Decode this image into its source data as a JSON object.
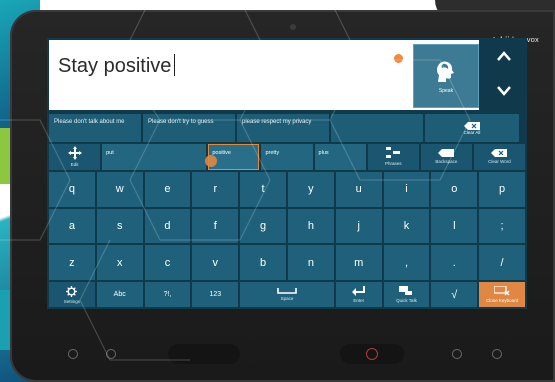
{
  "device": {
    "brand_bold": "tobii",
    "brand_light": "dynavox"
  },
  "message": {
    "text": "Stay positive",
    "speak_label": "Speak",
    "speak_icon": "speaking-head-icon",
    "scroll_up_icon": "chevron-up-icon",
    "scroll_down_icon": "chevron-down-icon"
  },
  "phrases": [
    "Please don't talk about me",
    "Please don't try to guess",
    "please respect my privacy",
    ""
  ],
  "clear_all": {
    "label": "Clear All"
  },
  "predictions": {
    "edit": "Edit",
    "words": [
      "put",
      "positive",
      "pretty",
      "plus"
    ],
    "selected_index": 1,
    "phrases": "Phrases",
    "backspace": "Backspace",
    "clear_word": "Clear Word"
  },
  "keyboard": {
    "row1": [
      "q",
      "w",
      "e",
      "r",
      "t",
      "y",
      "u",
      "i",
      "o",
      "p"
    ],
    "row2": [
      "a",
      "s",
      "d",
      "f",
      "g",
      "h",
      "j",
      "k",
      "l",
      ";"
    ],
    "row3": [
      "z",
      "x",
      "c",
      "v",
      "b",
      "n",
      "m",
      ",",
      ".",
      "/"
    ],
    "bottom": {
      "settings": "Settings",
      "abc": "Abc",
      "punct": "?!,",
      "numbers": "123",
      "space": "Space",
      "enter": "Enter",
      "quick_talk": "Quick Talk",
      "check": "√",
      "close": "Close Keyboard"
    }
  },
  "colors": {
    "key": "#1f617b",
    "accent": "#e08743",
    "screen_bg": "#103a4c"
  }
}
